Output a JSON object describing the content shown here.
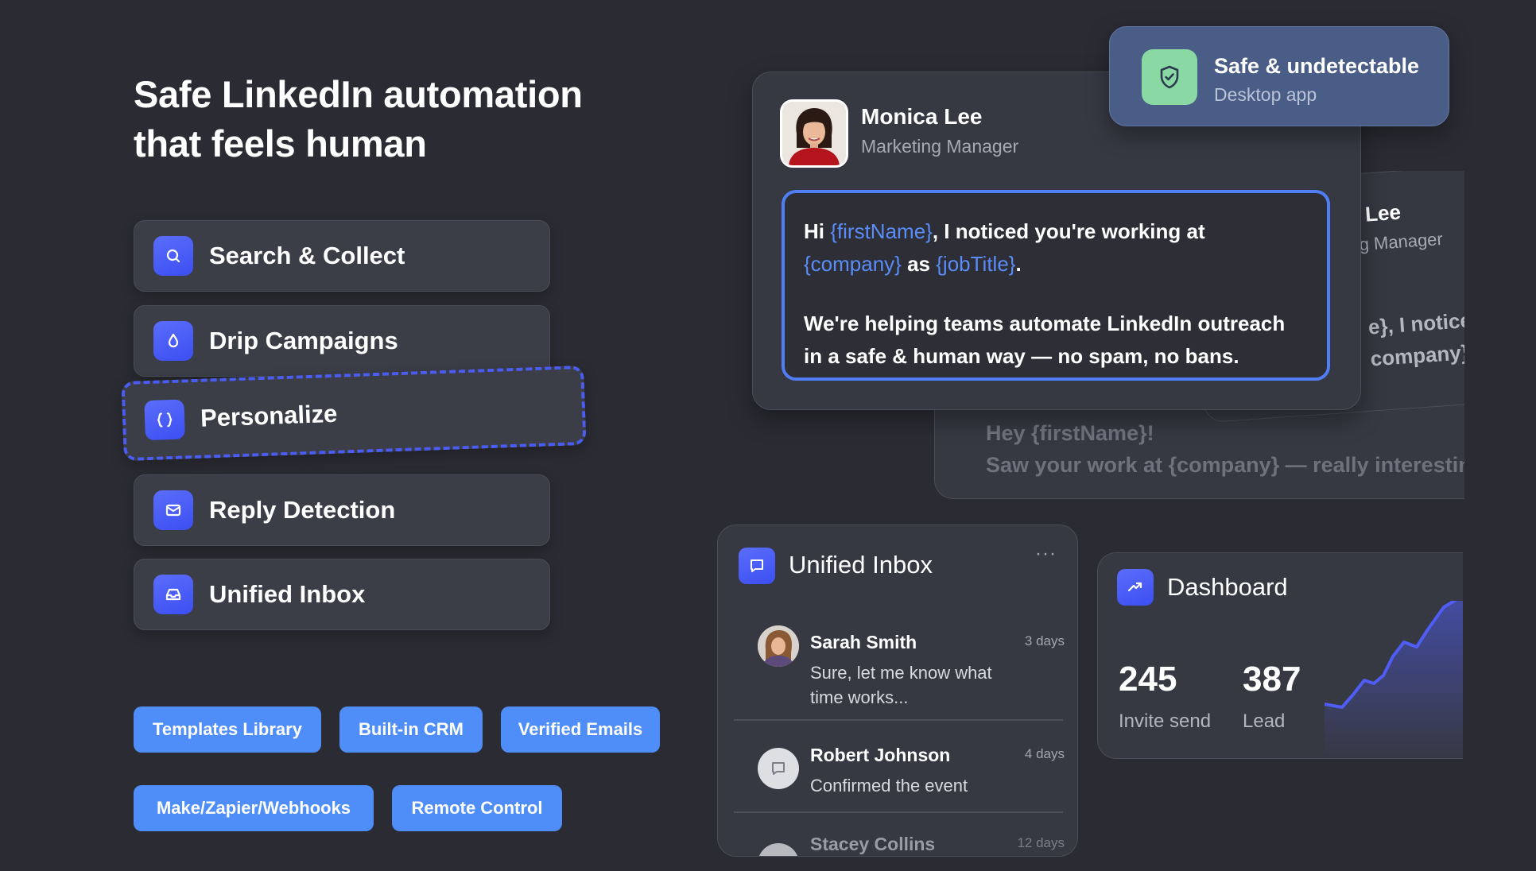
{
  "headline": {
    "line1": "Safe LinkedIn automation",
    "line2": "that feels human"
  },
  "features": [
    {
      "label": "Search & Collect",
      "icon": "search-icon"
    },
    {
      "label": "Drip Campaigns",
      "icon": "drop-icon"
    },
    {
      "label": "Personalize",
      "icon": "braces-icon"
    },
    {
      "label": "Reply Detection",
      "icon": "envelope-icon"
    },
    {
      "label": "Unified Inbox",
      "icon": "inbox-icon"
    }
  ],
  "tags": [
    "Templates Library",
    "Built-in CRM",
    "Verified Emails",
    "Make/Zapier/Webhooks",
    "Remote Control"
  ],
  "safe_badge": {
    "title": "Safe & undetectable",
    "subtitle": "Desktop app"
  },
  "profile": {
    "name": "Monica Lee",
    "role": "Marketing Manager"
  },
  "message": {
    "p1_a": "Hi ",
    "var_first": "{firstName}",
    "p1_b": ", I noticed you're working at ",
    "var_company": "{company}",
    "p1_c": " as ",
    "var_job": "{jobTitle}",
    "p1_d": ".",
    "p2": "We're helping teams automate LinkedIn outreach in a safe & human way — no spam, no bans."
  },
  "back_card_1": {
    "name": "Lee",
    "role": "g Manager",
    "text1": "e}, I notice",
    "text2": "company}"
  },
  "back_card_2": {
    "line1": "Hey {firstName}!",
    "line2": "Saw your work at {company} — really interestin"
  },
  "inbox": {
    "title": "Unified Inbox",
    "more": "···",
    "items": [
      {
        "name": "Sarah Smith",
        "time": "3 days",
        "preview": "Sure, let me know what time works..."
      },
      {
        "name": "Robert Johnson",
        "time": "4 days",
        "preview": "Confirmed the event"
      },
      {
        "name": "Stacey Collins",
        "time": "12 days",
        "preview": ""
      }
    ]
  },
  "dashboard": {
    "title": "Dashboard",
    "stats": [
      {
        "value": "245",
        "label": "Invite send"
      },
      {
        "value": "387",
        "label": "Lead"
      }
    ]
  },
  "colors": {
    "background": "#2b2c33",
    "accent": "#4f5df5",
    "tag": "#4f8ef8",
    "variable": "#5a8dfa",
    "safe_icon": "#8ad8a4"
  }
}
